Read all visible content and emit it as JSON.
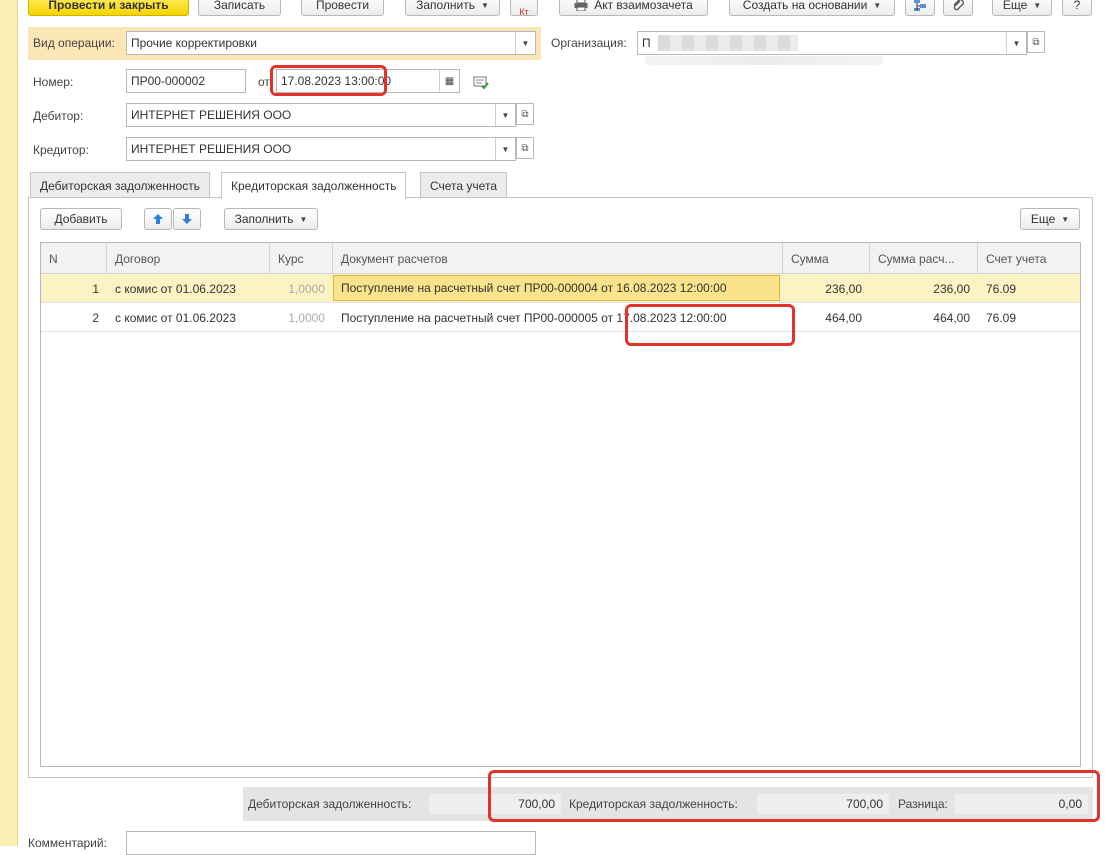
{
  "toolbar": {
    "post_close": "Провести и закрыть",
    "save": "Записать",
    "post": "Провести",
    "fill": "Заполнить",
    "dt_kt": "Кт",
    "act": "Акт взаимозачета",
    "create_based": "Создать на основании",
    "more": "Еще",
    "help": "?"
  },
  "form": {
    "operation_type_label": "Вид операции:",
    "operation_type_value": "Прочие корректировки",
    "organization_label": "Организация:",
    "organization_value": "П",
    "number_label": "Номер:",
    "number_value": "ПР00-000002",
    "date_from_label": "от",
    "date_value": "17.08.2023 13:00:00",
    "debtor_label": "Дебитор:",
    "debtor_value": "ИНТЕРНЕТ РЕШЕНИЯ ООО",
    "creditor_label": "Кредитор:",
    "creditor_value": "ИНТЕРНЕТ РЕШЕНИЯ ООО",
    "comment_label": "Комментарий:",
    "comment_value": ""
  },
  "tabs": [
    {
      "label": "Дебиторская задолженность",
      "active": false
    },
    {
      "label": "Кредиторская задолженность",
      "active": true
    },
    {
      "label": "Счета учета",
      "active": false
    }
  ],
  "table_toolbar": {
    "add": "Добавить",
    "fill": "Заполнить",
    "more": "Еще"
  },
  "table": {
    "columns": [
      "N",
      "Договор",
      "Курс",
      "Документ расчетов",
      "Сумма",
      "Сумма расч...",
      "Счет учета"
    ],
    "rows": [
      {
        "n": "1",
        "contract": "с комис от 01.06.2023",
        "rate": "1,0000",
        "document": "Поступление на расчетный счет ПР00-000004 от 16.08.2023 12:00:00",
        "sum": "236,00",
        "sum_calc": "236,00",
        "account": "76.09"
      },
      {
        "n": "2",
        "contract": "с комис от 01.06.2023",
        "rate": "1,0000",
        "document": "Поступление на расчетный счет ПР00-000005 от 17.08.2023 12:00:00",
        "sum": "464,00",
        "sum_calc": "464,00",
        "account": "76.09"
      }
    ]
  },
  "totals": {
    "debit_label": "Дебиторская задолженность:",
    "debit_value": "700,00",
    "credit_label": "Кредиторская задолженность:",
    "credit_value": "700,00",
    "diff_label": "Разница:",
    "diff_value": "0,00"
  },
  "colors": {
    "accent_yellow": "#f6d400",
    "highlight_red": "#e0342b",
    "selected_row": "#fcf3c4"
  }
}
